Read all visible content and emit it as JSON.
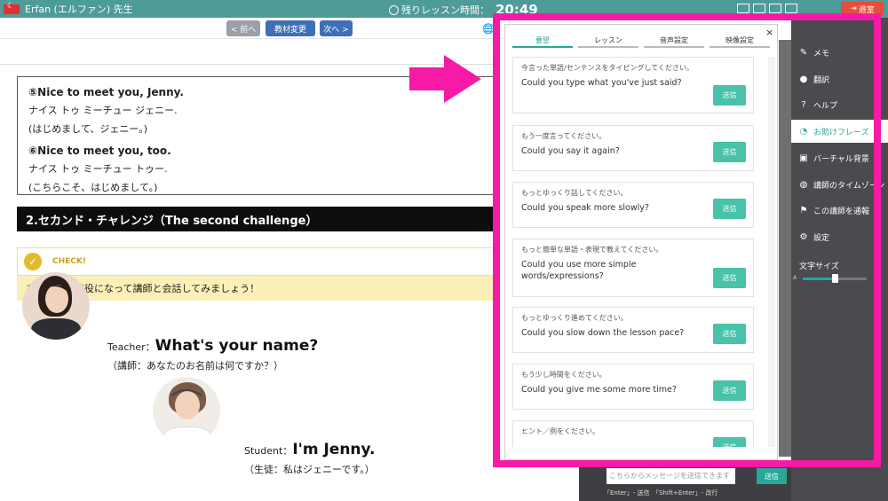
{
  "topbar": {
    "teacher": "Erfan (エルファン) 先生",
    "remaining_label": "残りレッスン時間：",
    "remaining_time": "20:49",
    "exit_label": "退室"
  },
  "nav": {
    "prev": "< 前へ",
    "change": "教材変更",
    "next": "次へ >"
  },
  "dialog": {
    "line1_en": "⑤Nice to meet you, Jenny.",
    "line1_kana": "ナイス トゥ ミーチュー ジェニー.",
    "line1_jp": "(はじめまして、ジェニー。)",
    "line2_en": "⑥Nice to meet you, too.",
    "line2_kana": "ナイス トゥ ミーチュー トゥー.",
    "line2_jp": "(こちらこそ、はじめまして。)"
  },
  "section_title": "2.セカンド・チャレンジ（The second challenge）",
  "check": {
    "label": "CHECK!",
    "body": "あなたが生徒役になって講師と会話してみましょう！"
  },
  "teacher_speech": {
    "role": "Teacher：",
    "text": "What's your name?",
    "jp": "（講師：あなたのお名前は何ですか？）"
  },
  "student_speech": {
    "role": "Student：",
    "text": "I'm Jenny.",
    "jp": "（生徒：私はジェニーです。）"
  },
  "phrase_panel": {
    "tabs": [
      "要望",
      "レッスン",
      "音声設定",
      "映像設定"
    ],
    "close": "×",
    "send_label": "送信",
    "phrases": [
      {
        "jp": "今言った単語/センテンスをタイピングしてください。",
        "en": "Could you type what you've just said?"
      },
      {
        "jp": "もう一度言ってください。",
        "en": "Could you say it again?"
      },
      {
        "jp": "もっとゆっくり話してください。",
        "en": "Could you speak more slowly?"
      },
      {
        "jp": "もっと簡単な単語・表現で教えてください。",
        "en": "Could you use more simple words/expressions?"
      },
      {
        "jp": "もっとゆっくり進めてください。",
        "en": "Could you slow down the lesson pace?"
      },
      {
        "jp": "もう少し時間をください。",
        "en": "Could you give me some more time?"
      },
      {
        "jp": "ヒント／例をください。",
        "en": ""
      }
    ]
  },
  "sidebar": {
    "items": [
      {
        "label": "メモ",
        "icon": "pencil-icon"
      },
      {
        "label": "翻訳",
        "icon": "globe-icon"
      },
      {
        "label": "ヘルプ",
        "icon": "question-icon"
      },
      {
        "label": "お助けフレーズ",
        "icon": "speech-bubble-icon"
      },
      {
        "label": "バーチャル背景",
        "icon": "picture-icon"
      },
      {
        "label": "講師のタイムゾーン",
        "icon": "globe-clock-icon"
      },
      {
        "label": "この講師を通報",
        "icon": "flag-icon"
      },
      {
        "label": "設定",
        "icon": "gear-icon"
      }
    ],
    "font_size_label": "文字サイズ",
    "font_size_level": 0.5
  },
  "chat": {
    "placeholder": "こちらからメッセージを送信できます",
    "send": "送信",
    "hint": "「Enter」- 送信　「Shift+Enter」- 改行"
  },
  "colors": {
    "accent": "#2aa79b",
    "highlight_frame": "#f71aa6",
    "topbar": "#4e9b9a",
    "exit": "#e74c3c"
  }
}
